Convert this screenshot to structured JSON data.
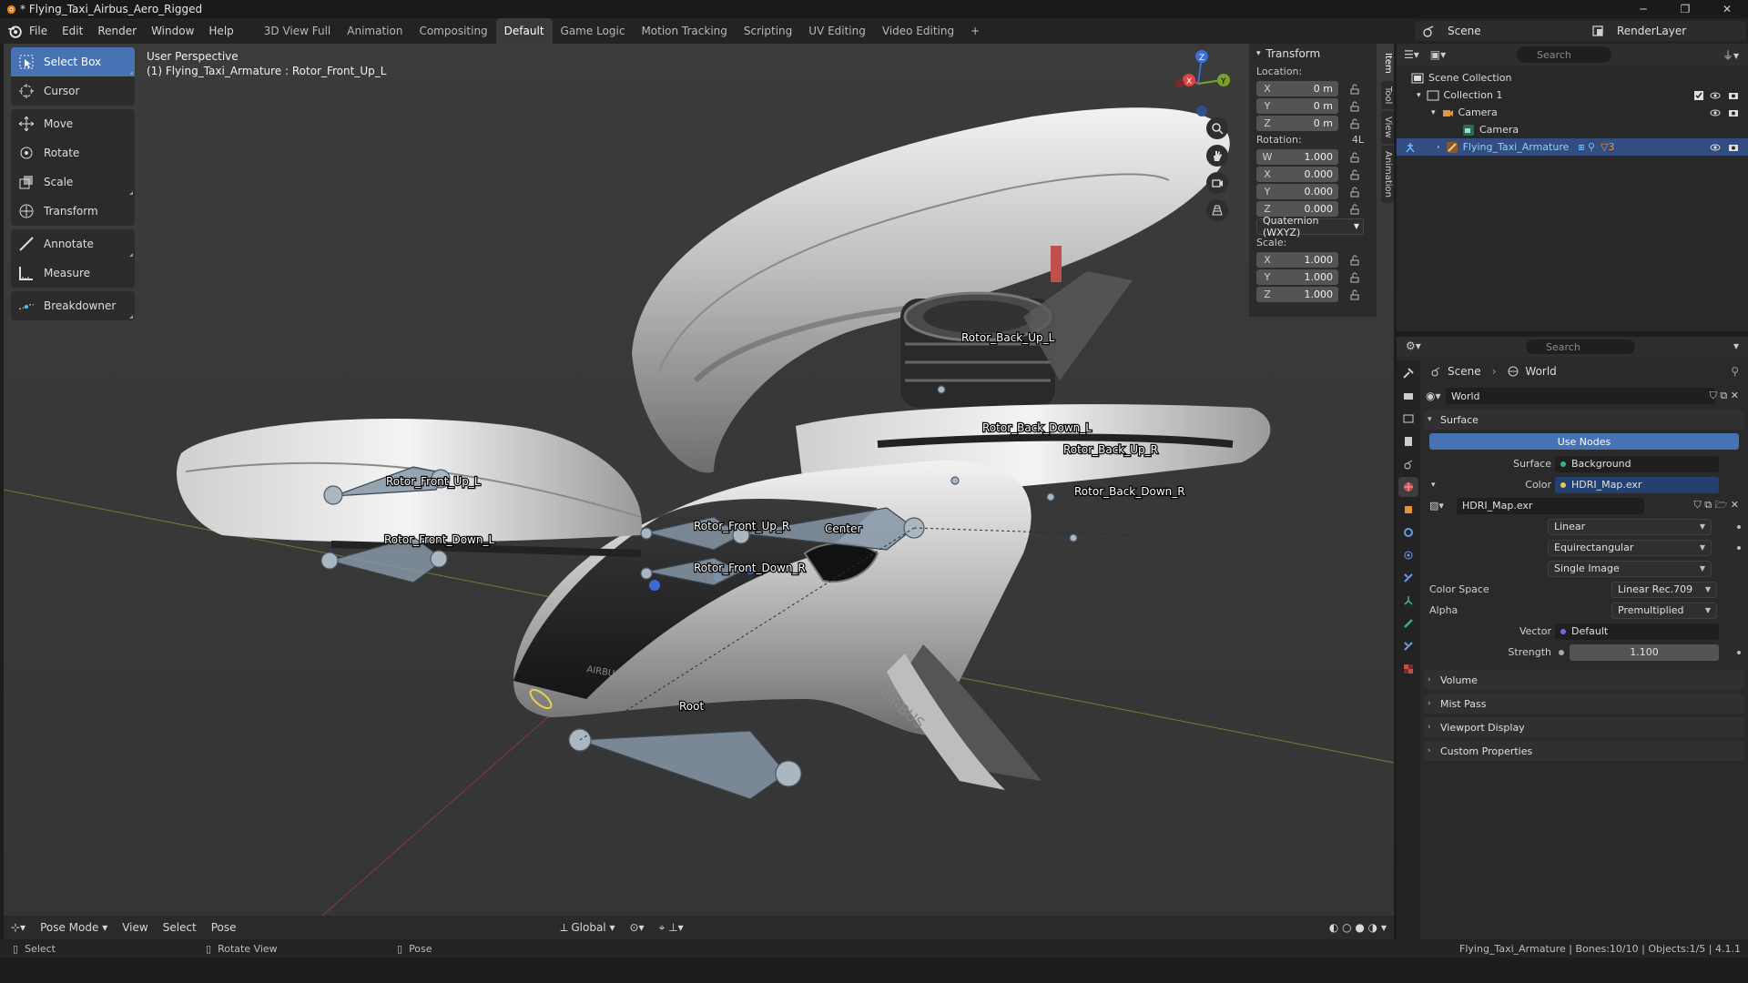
{
  "window": {
    "title": "* Flying_Taxi_Airbus_Aero_Rigged"
  },
  "menu": [
    "File",
    "Edit",
    "Render",
    "Window",
    "Help"
  ],
  "workspaces": [
    "3D View Full",
    "Animation",
    "Compositing",
    "Default",
    "Game Logic",
    "Motion Tracking",
    "Scripting",
    "UV Editing",
    "Video Editing",
    "+"
  ],
  "active_workspace": "Default",
  "scene_selector": "Scene",
  "render_layer": "RenderLayer",
  "toolbar": {
    "tools": [
      "Select Box",
      "Cursor",
      "Move",
      "Rotate",
      "Scale",
      "Transform",
      "Annotate",
      "Measure",
      "Breakdowner"
    ],
    "active": "Select Box"
  },
  "viewport": {
    "perspective": "User Perspective",
    "active_item": "(1) Flying_Taxi_Armature : Rotor_Front_Up_L",
    "bone_labels": [
      "Rotor_Front_Up_L",
      "Rotor_Front_Down_L",
      "Rotor_Front_Up_R",
      "Rotor_Front_Down_R",
      "Center",
      "Root",
      "Rotor_Back_Up_L",
      "Rotor_Back_Down_L",
      "Rotor_Back_Up_R",
      "Rotor_Back_Down_R"
    ],
    "brand_text": "AIRBUS",
    "gizmo_axes": [
      "X",
      "Y",
      "Z"
    ]
  },
  "npanel": {
    "header": "Transform",
    "location_label": "Location:",
    "location": [
      {
        "axis": "X",
        "value": "0 m"
      },
      {
        "axis": "Y",
        "value": "0 m"
      },
      {
        "axis": "Z",
        "value": "0 m"
      }
    ],
    "rotation_label": "Rotation:",
    "rotation_suffix": "4L",
    "rotation": [
      {
        "axis": "W",
        "value": "1.000"
      },
      {
        "axis": "X",
        "value": "0.000"
      },
      {
        "axis": "Y",
        "value": "0.000"
      },
      {
        "axis": "Z",
        "value": "0.000"
      }
    ],
    "rotation_mode": "Quaternion (WXYZ)",
    "scale_label": "Scale:",
    "scale": [
      {
        "axis": "X",
        "value": "1.000"
      },
      {
        "axis": "Y",
        "value": "1.000"
      },
      {
        "axis": "Z",
        "value": "1.000"
      }
    ],
    "tabs": [
      "Item",
      "Tool",
      "View",
      "Animation"
    ]
  },
  "vheader": {
    "mode": "Pose Mode",
    "menus": [
      "View",
      "Select",
      "Pose"
    ],
    "orientation": "Global"
  },
  "statusbar": {
    "hints": [
      "Select",
      "Rotate View",
      "Pose"
    ],
    "info": "Flying_Taxi_Armature | Bones:10/10 | Objects:1/5 | 4.1.1"
  },
  "outliner": {
    "search_placeholder": "Search",
    "rows": [
      {
        "label": "Scene Collection",
        "indent": 0
      },
      {
        "label": "Collection 1",
        "indent": 1
      },
      {
        "label": "Camera",
        "indent": 2
      },
      {
        "label": "Camera",
        "indent": 3
      },
      {
        "label": "Flying_Taxi_Armature",
        "indent": 2,
        "selected": true
      }
    ],
    "armature_badge": "3"
  },
  "properties": {
    "search_placeholder": "Search",
    "breadcrumb": [
      "Scene",
      "World"
    ],
    "world_name": "World",
    "surface_panel": "Surface",
    "use_nodes": "Use Nodes",
    "surface_label": "Surface",
    "surface_value": "Background",
    "color_label": "Color",
    "color_value": "HDRI_Map.exr",
    "image_name": "HDRI_Map.exr",
    "interpolation": "Linear",
    "projection": "Equirectangular",
    "source": "Single Image",
    "color_space_label": "Color Space",
    "color_space": "Linear Rec.709",
    "alpha_label": "Alpha",
    "alpha": "Premultiplied",
    "vector_label": "Vector",
    "vector": "Default",
    "strength_label": "Strength",
    "strength": "1.100",
    "collapsed_panels": [
      "Volume",
      "Mist Pass",
      "Viewport Display",
      "Custom Properties"
    ]
  }
}
